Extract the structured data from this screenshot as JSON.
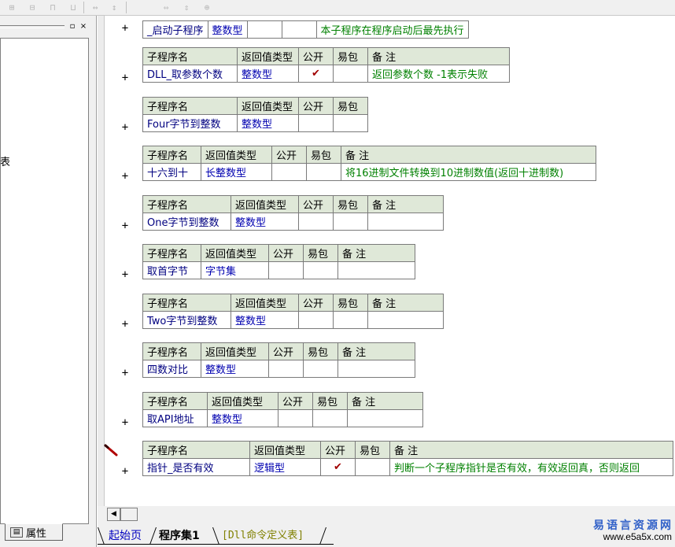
{
  "left_panel": {
    "tree_text": "表",
    "controls": {
      "restore": "▫",
      "close": "×"
    },
    "props_tab_label": "属性"
  },
  "headers": {
    "name": "子程序名",
    "return_type": "返回值类型",
    "public": "公开",
    "easy_pkg": "易包",
    "note": "备 注"
  },
  "first_row": {
    "name": "_启动子程序",
    "return_type": "整数型",
    "note": "本子程序在程序启动后最先执行"
  },
  "subs": [
    {
      "name": "DLL_取参数个数",
      "return_type": "整数型",
      "public": "✔",
      "note": "返回参数个数 -1表示失败"
    },
    {
      "name": "Four字节到整数",
      "return_type": "整数型",
      "public": "",
      "note": ""
    },
    {
      "name": "十六到十",
      "return_type": "长整数型",
      "public": "",
      "note": "将16进制文件转换到10进制数值(返回十进制数)"
    },
    {
      "name": "One字节到整数",
      "return_type": "整数型",
      "public": "",
      "note": ""
    },
    {
      "name": "取首字节",
      "return_type": "字节集",
      "public": "",
      "note": ""
    },
    {
      "name": "Two字节到整数",
      "return_type": "整数型",
      "public": "",
      "note": ""
    },
    {
      "name": "四数对比",
      "return_type": "整数型",
      "public": "",
      "note": ""
    },
    {
      "name": "取API地址",
      "return_type": "整数型",
      "public": "",
      "note": ""
    },
    {
      "name": "指针_是否有效",
      "return_type": "逻辑型",
      "public": "✔",
      "note": "判断一个子程序指针是否有效，有效返回真，否则返回"
    }
  ],
  "expand_glyph": "+",
  "bottom_tabs": {
    "start_page": "起始页",
    "program_set": "程序集1",
    "dll_defs": "[Dll命令定义表]"
  },
  "watermark": {
    "name": "易语言资源网",
    "url": "www.e5a5x.com"
  },
  "colors": {
    "header_bg": "#dfe8d8",
    "name_text": "#000080",
    "type_text": "#0000b0",
    "note_text": "#008000",
    "check_mark": "#a00000"
  }
}
